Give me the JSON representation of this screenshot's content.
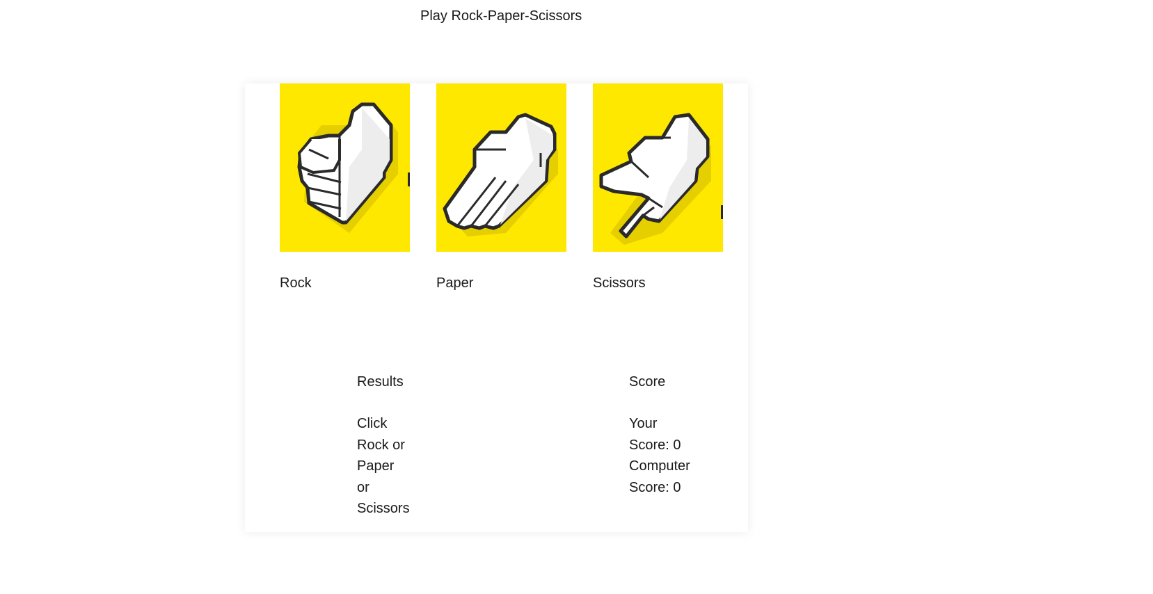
{
  "page": {
    "title": "Play Rock-Paper-Scissors"
  },
  "choices": [
    {
      "label": "Rock",
      "icon": "rock-hand-icon"
    },
    {
      "label": "Paper",
      "icon": "paper-hand-icon"
    },
    {
      "label": "Scissors",
      "icon": "scissors-hand-icon"
    }
  ],
  "results": {
    "heading": "Results",
    "message": "Click Rock or Paper or Scissors"
  },
  "score": {
    "heading": "Score",
    "your_score": "Your Score: 0",
    "computer_score": "Computer Score: 0"
  },
  "colors": {
    "tile": "#FFE800",
    "outline": "#2a2a2a",
    "shadow": "#E6CF00"
  }
}
